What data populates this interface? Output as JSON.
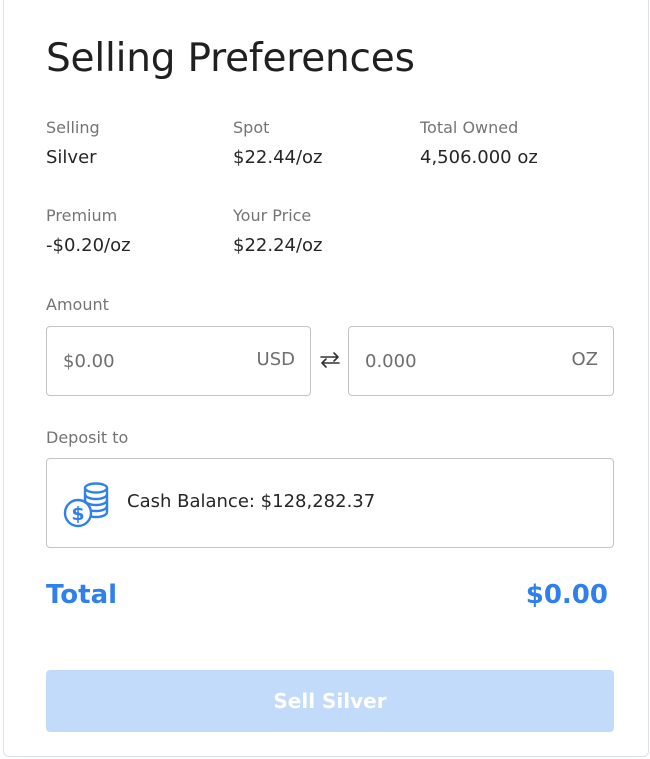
{
  "title": "Selling Preferences",
  "stats": {
    "selling": {
      "label": "Selling",
      "value": "Silver"
    },
    "spot": {
      "label": "Spot",
      "value": "$22.44/oz"
    },
    "total_owned": {
      "label": "Total Owned",
      "value": "4,506.000 oz"
    },
    "premium": {
      "label": "Premium",
      "value": "-$0.20/oz"
    },
    "your_price": {
      "label": "Your Price",
      "value": "$22.24/oz"
    }
  },
  "amount": {
    "label": "Amount",
    "usd": {
      "placeholder": "$0.00",
      "unit": "USD"
    },
    "oz": {
      "placeholder": "0.000",
      "unit": "OZ"
    }
  },
  "deposit": {
    "label": "Deposit to",
    "option": "Cash Balance: $128,282.37",
    "icon": "coins-dollar-icon"
  },
  "total": {
    "label": "Total",
    "value": "$0.00"
  },
  "sell_button": {
    "label": "Sell Silver",
    "enabled": false
  },
  "colors": {
    "accent": "#2f80ed",
    "button_disabled": "#c3dbfa",
    "border": "#c4c4c4",
    "muted_text": "#747474"
  }
}
